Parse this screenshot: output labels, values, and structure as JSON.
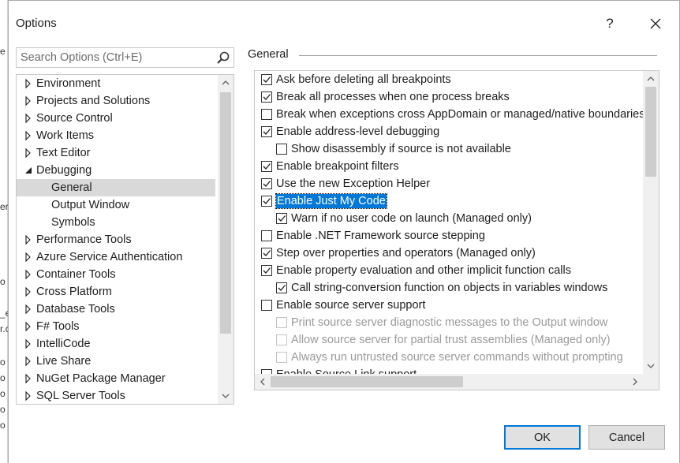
{
  "window": {
    "title": "Options",
    "help_label": "?",
    "close_label": "✕"
  },
  "search": {
    "placeholder": "Search Options (Ctrl+E)"
  },
  "tree": {
    "items": [
      {
        "label": "Environment",
        "level": 0,
        "expanded": false
      },
      {
        "label": "Projects and Solutions",
        "level": 0,
        "expanded": false
      },
      {
        "label": "Source Control",
        "level": 0,
        "expanded": false
      },
      {
        "label": "Work Items",
        "level": 0,
        "expanded": false
      },
      {
        "label": "Text Editor",
        "level": 0,
        "expanded": false
      },
      {
        "label": "Debugging",
        "level": 0,
        "expanded": true
      },
      {
        "label": "General",
        "level": 1,
        "selected": true
      },
      {
        "label": "Output Window",
        "level": 1
      },
      {
        "label": "Symbols",
        "level": 1
      },
      {
        "label": "Performance Tools",
        "level": 0,
        "expanded": false
      },
      {
        "label": "Azure Service Authentication",
        "level": 0,
        "expanded": false
      },
      {
        "label": "Container Tools",
        "level": 0,
        "expanded": false
      },
      {
        "label": "Cross Platform",
        "level": 0,
        "expanded": false
      },
      {
        "label": "Database Tools",
        "level": 0,
        "expanded": false
      },
      {
        "label": "F# Tools",
        "level": 0,
        "expanded": false
      },
      {
        "label": "IntelliCode",
        "level": 0,
        "expanded": false
      },
      {
        "label": "Live Share",
        "level": 0,
        "expanded": false
      },
      {
        "label": "NuGet Package Manager",
        "level": 0,
        "expanded": false
      },
      {
        "label": "SQL Server Tools",
        "level": 0,
        "expanded": false
      }
    ]
  },
  "section": {
    "title": "General"
  },
  "options": [
    {
      "label": "Ask before deleting all breakpoints",
      "level": 0,
      "checked": true,
      "enabled": true
    },
    {
      "label": "Break all processes when one process breaks",
      "level": 0,
      "checked": true,
      "enabled": true
    },
    {
      "label": "Break when exceptions cross AppDomain or managed/native boundaries",
      "level": 0,
      "checked": false,
      "enabled": true
    },
    {
      "label": "Enable address-level debugging",
      "level": 0,
      "checked": true,
      "enabled": true
    },
    {
      "label": "Show disassembly if source is not available",
      "level": 1,
      "checked": false,
      "enabled": true
    },
    {
      "label": "Enable breakpoint filters",
      "level": 0,
      "checked": true,
      "enabled": true
    },
    {
      "label": "Use the new Exception Helper",
      "level": 0,
      "checked": true,
      "enabled": true
    },
    {
      "label": "Enable Just My Code",
      "level": 0,
      "checked": true,
      "enabled": true,
      "focused": true
    },
    {
      "label": "Warn if no user code on launch (Managed only)",
      "level": 1,
      "checked": true,
      "enabled": true
    },
    {
      "label": "Enable .NET Framework source stepping",
      "level": 0,
      "checked": false,
      "enabled": true
    },
    {
      "label": "Step over properties and operators (Managed only)",
      "level": 0,
      "checked": true,
      "enabled": true
    },
    {
      "label": "Enable property evaluation and other implicit function calls",
      "level": 0,
      "checked": true,
      "enabled": true
    },
    {
      "label": "Call string-conversion function on objects in variables windows",
      "level": 1,
      "checked": true,
      "enabled": true
    },
    {
      "label": "Enable source server support",
      "level": 0,
      "checked": false,
      "enabled": true
    },
    {
      "label": "Print source server diagnostic messages to the Output window",
      "level": 1,
      "checked": false,
      "enabled": false
    },
    {
      "label": "Allow source server for partial trust assemblies (Managed only)",
      "level": 1,
      "checked": false,
      "enabled": false
    },
    {
      "label": "Always run untrusted source server commands without prompting",
      "level": 1,
      "checked": false,
      "enabled": false
    },
    {
      "label": "Enable Source Link support",
      "level": 0,
      "checked": false,
      "enabled": true
    }
  ],
  "buttons": {
    "ok": "OK",
    "cancel": "Cancel"
  },
  "colors": {
    "selection": "#0078d7",
    "tree_selected": "#d9d9d9"
  }
}
